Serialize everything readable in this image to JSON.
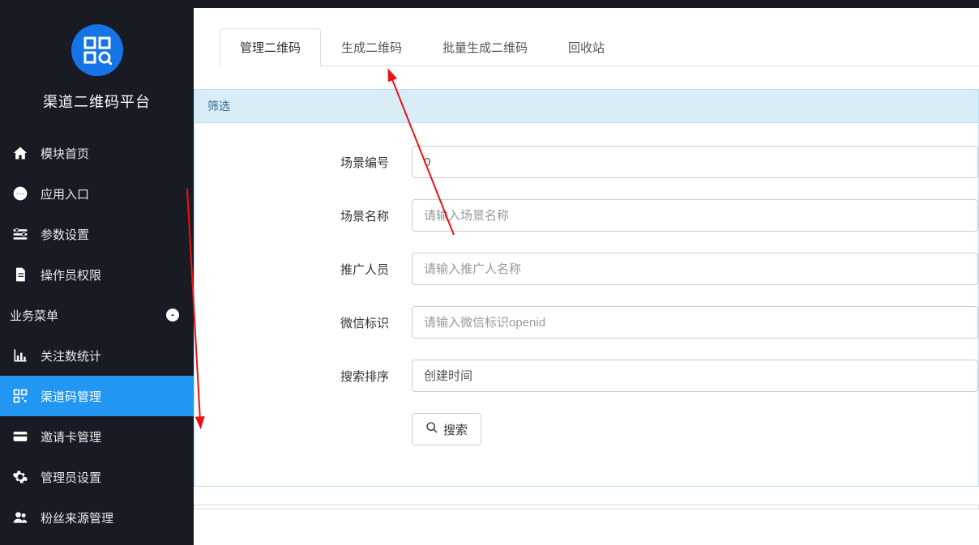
{
  "brand": {
    "title": "渠道二维码平台"
  },
  "sidebar": {
    "items": [
      {
        "label": "模块首页"
      },
      {
        "label": "应用入口"
      },
      {
        "label": "参数设置"
      },
      {
        "label": "操作员权限"
      }
    ],
    "section_label": "业务菜单",
    "sub_items": [
      {
        "label": "关注数统计"
      },
      {
        "label": "渠道码管理"
      },
      {
        "label": "邀请卡管理"
      },
      {
        "label": "管理员设置"
      },
      {
        "label": "粉丝来源管理"
      }
    ]
  },
  "tabs": [
    {
      "label": "管理二维码",
      "active": true
    },
    {
      "label": "生成二维码",
      "active": false
    },
    {
      "label": "批量生成二维码",
      "active": false
    },
    {
      "label": "回收站",
      "active": false
    }
  ],
  "filter": {
    "title": "筛选",
    "scene_id_label": "场景编号",
    "scene_id_value": "0",
    "scene_name_label": "场景名称",
    "scene_name_placeholder": "请输入场景名称",
    "promoter_label": "推广人员",
    "promoter_placeholder": "请输入推广人名称",
    "wechat_label": "微信标识",
    "wechat_placeholder": "请输入微信标识openid",
    "sort_label": "搜索排序",
    "sort_value": "创建时间",
    "search_label": "搜索"
  }
}
